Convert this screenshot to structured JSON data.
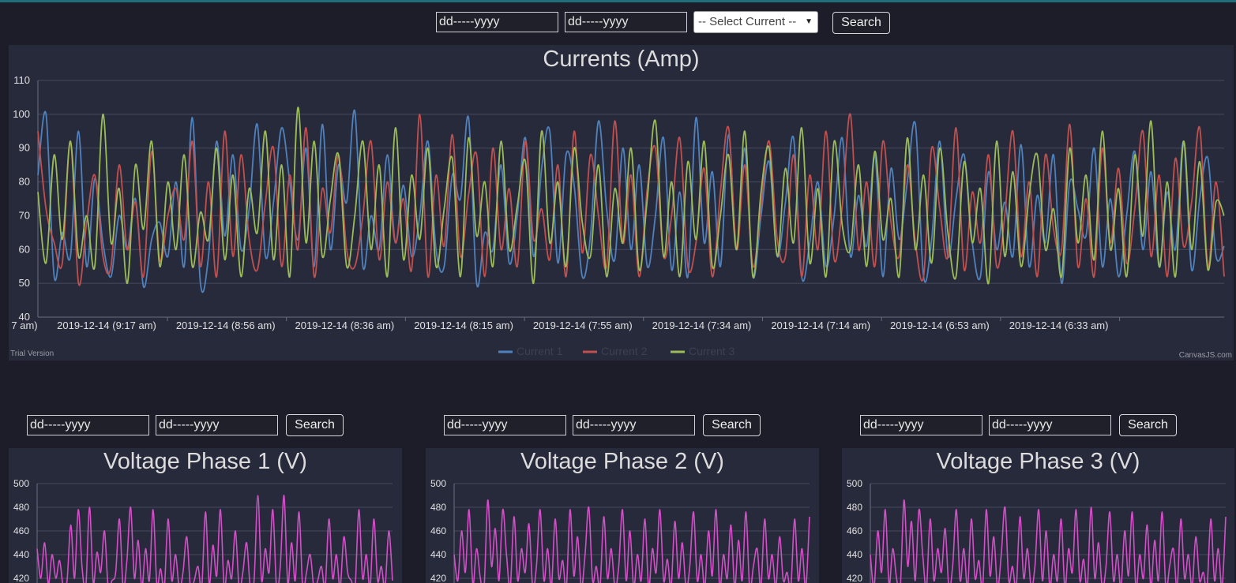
{
  "top_controls": {
    "date_from": "dd-----yyyy",
    "date_to": "dd-----yyyy",
    "select_current": "-- Select Current --",
    "search_label": "Search"
  },
  "currents_chart": {
    "title": "Currents (Amp)",
    "trial_text": "Trial Version",
    "credit_text": "CanvasJS.com",
    "x_tick_labels": [
      "7 am)",
      "2019-12-14 (9:17 am)",
      "2019-12-14 (8:56 am)",
      "2019-12-14 (8:36 am)",
      "2019-12-14 (8:15 am)",
      "2019-12-14 (7:55 am)",
      "2019-12-14 (7:34 am)",
      "2019-12-14 (7:14 am)",
      "2019-12-14 (6:53 am)",
      "2019-12-14 (6:33 am)"
    ],
    "legend": [
      "Current 1",
      "Current 2",
      "Current 3"
    ]
  },
  "voltage_panels": [
    {
      "title": "Voltage Phase 1 (V)",
      "date_from": "dd-----yyyy",
      "date_to": "dd-----yyyy",
      "search_label": "Search"
    },
    {
      "title": "Voltage Phase 2 (V)",
      "date_from": "dd-----yyyy",
      "date_to": "dd-----yyyy",
      "search_label": "Search"
    },
    {
      "title": "Voltage Phase 3 (V)",
      "date_from": "dd-----yyyy",
      "date_to": "dd-----yyyy",
      "search_label": "Search"
    }
  ],
  "chart_data": [
    {
      "type": "line",
      "title": "Currents (Amp)",
      "ylim": [
        40,
        110
      ],
      "y_ticks": [
        40,
        50,
        60,
        70,
        80,
        90,
        100,
        110
      ],
      "x_tick_labels": [
        "7 am)",
        "2019-12-14 (9:17 am)",
        "2019-12-14 (8:56 am)",
        "2019-12-14 (8:36 am)",
        "2019-12-14 (8:15 am)",
        "2019-12-14 (7:55 am)",
        "2019-12-14 (7:34 am)",
        "2019-12-14 (7:14 am)",
        "2019-12-14 (6:53 am)",
        "2019-12-14 (6:33 am)"
      ],
      "grid": true,
      "legend_position": "bottom",
      "colors": [
        "#4f81bc",
        "#c0504e",
        "#9bbb58"
      ],
      "series": [
        {
          "name": "Current 1",
          "values": [
            82,
            100,
            52,
            65,
            58,
            95,
            55,
            81,
            62,
            52,
            70,
            60,
            75,
            49,
            63,
            68,
            58,
            80,
            55,
            99,
            50,
            58,
            92,
            64,
            88,
            60,
            72,
            97,
            58,
            74,
            96,
            80,
            63,
            90,
            55,
            97,
            60,
            85,
            74,
            101,
            55,
            70,
            60,
            88,
            62,
            79,
            58,
            70,
            92,
            60,
            55,
            82,
            75,
            99,
            50,
            65,
            60,
            85,
            56,
            70,
            93,
            58,
            84,
            95,
            56,
            88,
            79,
            52,
            64,
            98,
            72,
            57,
            90,
            60,
            85,
            55,
            70,
            93,
            54,
            77,
            52,
            99,
            62,
            83,
            55,
            94,
            60,
            90,
            52,
            70,
            86,
            58,
            74,
            93,
            52,
            62,
            80,
            55,
            70,
            93,
            58,
            76,
            61,
            88,
            52,
            84,
            63,
            80,
            97,
            52,
            63,
            92,
            58,
            75,
            88,
            62,
            52,
            83,
            60,
            74,
            58,
            91,
            55,
            76,
            62,
            88,
            50,
            80,
            72,
            64,
            90,
            55,
            75,
            52,
            70,
            89,
            60,
            83,
            55,
            77,
            60,
            92,
            54,
            75,
            87,
            58,
            61
          ]
        },
        {
          "name": "Current 2",
          "values": [
            95,
            72,
            62,
            56,
            92,
            50,
            68,
            82,
            58,
            55,
            85,
            60,
            74,
            52,
            89,
            57,
            70,
            78,
            63,
            92,
            55,
            80,
            52,
            95,
            58,
            88,
            63,
            54,
            74,
            90,
            55,
            82,
            60,
            96,
            52,
            78,
            65,
            88,
            60,
            55,
            70,
            92,
            57,
            80,
            62,
            75,
            54,
            100,
            52,
            82,
            61,
            94,
            58,
            76,
            88,
            52,
            90,
            60,
            78,
            55,
            92,
            63,
            72,
            57,
            85,
            52,
            95,
            59,
            88,
            70,
            55,
            98,
            62,
            82,
            52,
            78,
            90,
            58,
            70,
            93,
            55,
            62,
            84,
            52,
            77,
            96,
            60,
            85,
            55,
            73,
            92,
            63,
            58,
            88,
            52,
            82,
            60,
            95,
            57,
            73,
            100,
            60,
            80,
            55,
            92,
            68,
            58,
            85,
            62,
            52,
            90,
            72,
            58,
            96,
            54,
            77,
            62,
            88,
            55,
            70,
            95,
            58,
            80,
            52,
            88,
            66,
            60,
            97,
            55,
            75,
            52,
            90,
            62,
            84,
            56,
            72,
            95,
            58,
            82,
            52,
            87,
            61,
            74,
            96,
            55,
            80,
            52
          ]
        },
        {
          "name": "Current 3",
          "values": [
            77,
            56,
            88,
            63,
            92,
            58,
            70,
            55,
            100,
            62,
            78,
            50,
            85,
            66,
            92,
            55,
            80,
            60,
            88,
            55,
            71,
            63,
            90,
            57,
            82,
            52,
            78,
            65,
            95,
            57,
            85,
            52,
            102,
            62,
            92,
            58,
            75,
            88,
            55,
            70,
            92,
            60,
            85,
            52,
            96,
            57,
            82,
            63,
            90,
            55,
            72,
            87,
            52,
            93,
            64,
            80,
            55,
            92,
            60,
            73,
            86,
            50,
            95,
            62,
            80,
            55,
            90,
            68,
            58,
            85,
            52,
            78,
            62,
            90,
            54,
            75,
            98,
            58,
            80,
            52,
            86,
            63,
            92,
            55,
            70,
            88,
            60,
            95,
            52,
            77,
            90,
            58,
            84,
            62,
            96,
            56,
            78,
            52,
            92,
            67,
            60,
            85,
            55,
            89,
            63,
            75,
            52,
            93,
            60,
            82,
            56,
            90,
            65,
            52,
            86,
            62,
            78,
            50,
            92,
            58,
            83,
            55,
            76,
            88,
            60,
            72,
            52,
            90,
            62,
            82,
            57,
            95,
            60,
            78,
            52,
            88,
            64,
            98,
            55,
            80,
            52,
            92,
            60,
            86,
            54,
            74,
            70
          ]
        }
      ]
    },
    {
      "type": "line",
      "title": "Voltage Phase 1 (V)",
      "ylim": [
        410,
        500
      ],
      "y_ticks": [
        420,
        440,
        460,
        480,
        500
      ],
      "grid": true,
      "colors": [
        "#d24fc7"
      ],
      "series": [
        {
          "name": "",
          "values": [
            445,
            420,
            450,
            415,
            440,
            420,
            435,
            412,
            418,
            465,
            420,
            478,
            430,
            412,
            480,
            416,
            442,
            425,
            460,
            412,
            418,
            425,
            470,
            412,
            435,
            480,
            420,
            452,
            412,
            445,
            418,
            478,
            415,
            428,
            412,
            470,
            418,
            440,
            412,
            425,
            455,
            412,
            418,
            430,
            412,
            476,
            415,
            448,
            422,
            478,
            412,
            435,
            420,
            460,
            412,
            425,
            450,
            412,
            418,
            490,
            418,
            445,
            425,
            478,
            412,
            430,
            490,
            415,
            450,
            418,
            476,
            412,
            425,
            440,
            412,
            418,
            430,
            412,
            470,
            420,
            440,
            412,
            455,
            425,
            418,
            412,
            478,
            420,
            440,
            412,
            470,
            418,
            430,
            412,
            460,
            418
          ]
        }
      ]
    },
    {
      "type": "line",
      "title": "Voltage Phase 2 (V)",
      "ylim": [
        410,
        500
      ],
      "y_ticks": [
        420,
        440,
        460,
        480,
        500
      ],
      "grid": true,
      "colors": [
        "#d24fc7"
      ],
      "series": [
        {
          "name": "",
          "values": [
            440,
            418,
            460,
            425,
            478,
            415,
            445,
            420,
            412,
            486,
            430,
            462,
            418,
            478,
            440,
            412,
            472,
            418,
            445,
            425,
            466,
            412,
            430,
            478,
            418,
            445,
            412,
            470,
            420,
            435,
            412,
            478,
            422,
            455,
            412,
            440,
            480,
            418,
            430,
            412,
            472,
            420,
            445,
            412,
            430,
            478,
            418,
            460,
            412,
            440,
            418,
            470,
            412,
            445,
            425,
            478,
            418,
            436,
            412,
            468,
            420,
            450,
            412,
            430,
            476,
            418,
            440,
            412,
            460,
            422,
            478,
            412,
            440,
            420,
            465,
            412,
            452,
            418,
            476,
            412,
            430,
            445,
            412,
            470,
            420,
            440,
            412,
            455,
            418,
            425,
            412,
            470,
            418,
            445,
            412,
            472
          ]
        }
      ]
    },
    {
      "type": "line",
      "title": "Voltage Phase 3 (V)",
      "ylim": [
        410,
        500
      ],
      "y_ticks": [
        420,
        440,
        460,
        480,
        500
      ],
      "grid": true,
      "colors": [
        "#d24fc7"
      ],
      "series": [
        {
          "name": "",
          "values": [
            440,
            412,
            460,
            425,
            478,
            415,
            445,
            420,
            412,
            486,
            430,
            468,
            418,
            478,
            440,
            412,
            470,
            418,
            445,
            425,
            462,
            412,
            430,
            478,
            418,
            445,
            412,
            470,
            420,
            435,
            412,
            478,
            422,
            455,
            412,
            440,
            480,
            418,
            430,
            412,
            472,
            420,
            445,
            412,
            430,
            478,
            418,
            460,
            412,
            440,
            418,
            470,
            412,
            445,
            425,
            478,
            418,
            436,
            412,
            480,
            420,
            450,
            412,
            430,
            476,
            418,
            440,
            412,
            460,
            422,
            476,
            412,
            440,
            420,
            465,
            412,
            452,
            418,
            476,
            412,
            430,
            445,
            412,
            470,
            420,
            440,
            412,
            455,
            418,
            425,
            412,
            470,
            418,
            445,
            412,
            472
          ]
        }
      ]
    }
  ]
}
